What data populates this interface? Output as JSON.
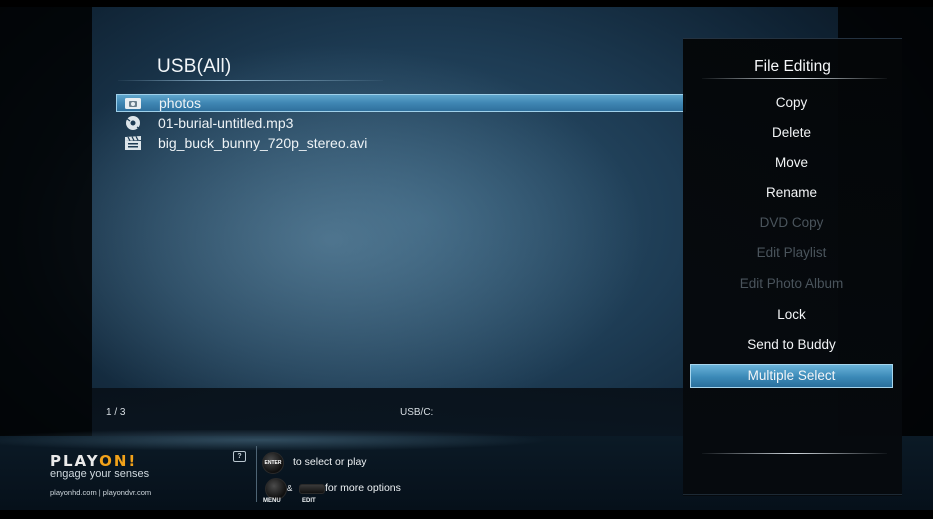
{
  "browser": {
    "title": "USB(All)",
    "files": [
      {
        "name": "photos",
        "icon": "folder-icon",
        "selected": true
      },
      {
        "name": "01-burial-untitled.mp3",
        "icon": "music-disc-icon",
        "selected": false
      },
      {
        "name": "big_buck_bunny_720p_stereo.avi",
        "icon": "video-clapper-icon",
        "selected": false
      }
    ],
    "page_counter": "1 / 3",
    "path": "USB/C:"
  },
  "menu": {
    "title": "File Editing",
    "items": [
      {
        "label": "Copy",
        "enabled": true,
        "selected": false
      },
      {
        "label": "Delete",
        "enabled": true,
        "selected": false
      },
      {
        "label": "Move",
        "enabled": true,
        "selected": false
      },
      {
        "label": "Rename",
        "enabled": true,
        "selected": false
      },
      {
        "label": "DVD Copy",
        "enabled": false,
        "selected": false
      },
      {
        "label": "Edit Playlist",
        "enabled": false,
        "selected": false
      },
      {
        "label": "Edit Photo Album",
        "enabled": false,
        "selected": false
      },
      {
        "label": "Lock",
        "enabled": true,
        "selected": false
      },
      {
        "label": "Send to Buddy",
        "enabled": true,
        "selected": false
      },
      {
        "label": "Multiple Select",
        "enabled": true,
        "selected": true
      }
    ]
  },
  "footer": {
    "logo_main": "PLAY",
    "logo_accent": "ON!",
    "tagline": "engage your senses",
    "site": "playonhd.com | playondvr.com",
    "help_icon": "?",
    "enter_button": "ENTER",
    "hint_select": "to select or play",
    "amp": "&",
    "hint_options": "for more options",
    "menu_caption": "MENU",
    "edit_caption": "EDIT"
  },
  "colors": {
    "highlight": "#4a95c2",
    "logo_accent": "#f2a21a",
    "disabled_text": "#4a545c"
  }
}
